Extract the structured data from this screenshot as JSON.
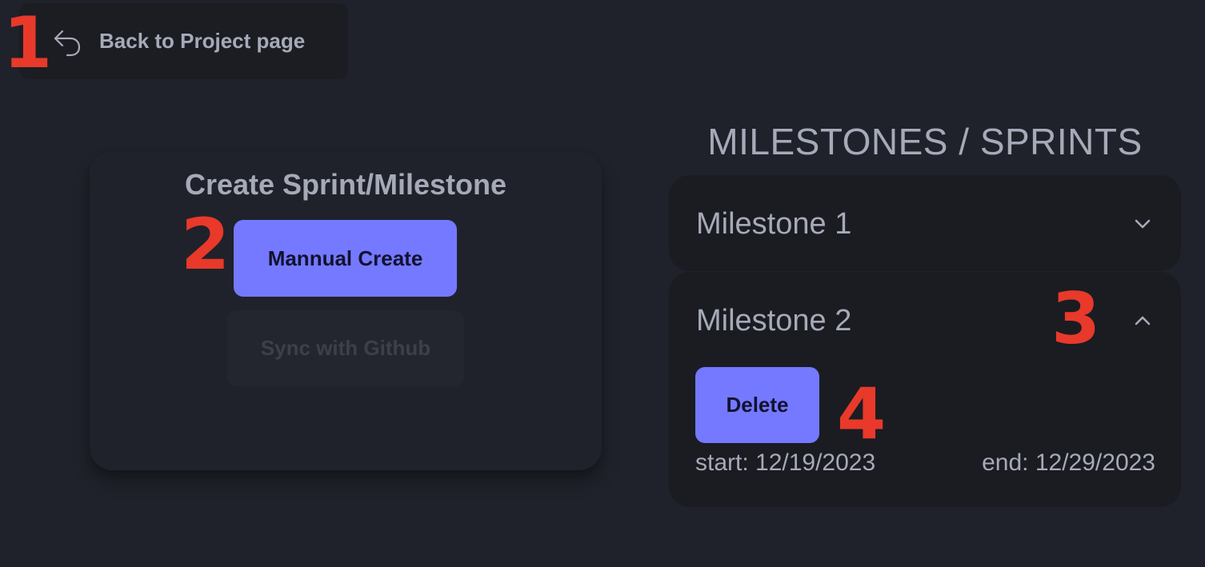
{
  "back": {
    "label": "Back to Project page",
    "icon": "undo-arrow-icon"
  },
  "create": {
    "title": "Create Sprint/Milestone",
    "manual_label": "Mannual Create",
    "sync_label": "Sync with Github"
  },
  "milestones": {
    "heading": "MILESTONES / SPRINTS",
    "items": [
      {
        "title": "Milestone 1",
        "expanded": false,
        "chevron": "chevron-down-icon"
      },
      {
        "title": "Milestone 2",
        "expanded": true,
        "chevron": "chevron-up-icon",
        "delete_label": "Delete",
        "start": "start: 12/19/2023",
        "end": "end: 12/29/2023"
      }
    ]
  },
  "annotations": [
    "1",
    "2",
    "3",
    "4"
  ],
  "colors": {
    "background": "#1f222a",
    "card": "#1a1c22",
    "accent": "#7479ff",
    "text": "#a6aab8",
    "annotation": "#e8392a"
  }
}
